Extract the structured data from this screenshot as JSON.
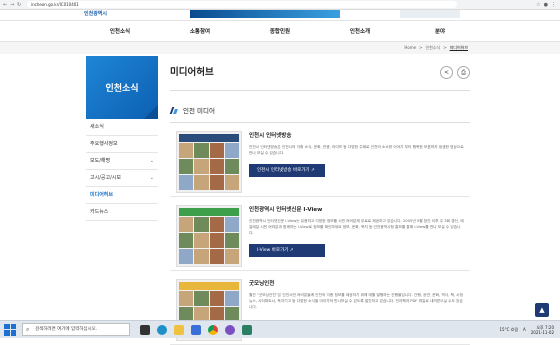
{
  "browser": {
    "url": "incheon.go.kr/IC010401",
    "nav_back": "←",
    "nav_fwd": "→",
    "reload": "↻"
  },
  "header": {
    "logo_text": "인천광역시"
  },
  "gnb": {
    "items": [
      "인천소식",
      "소통참여",
      "종합민원",
      "인천소개",
      "분야"
    ]
  },
  "breadcrumb": {
    "home": "Home",
    "sep": ">",
    "level1": "인천소식",
    "current": "미디어허브"
  },
  "lnb": {
    "title": "인천소식",
    "items": [
      {
        "label": "새소식",
        "chev": ""
      },
      {
        "label": "주요행사정보",
        "chev": ""
      },
      {
        "label": "보도/해명",
        "chev": "⌄"
      },
      {
        "label": "고시/공고/시보",
        "chev": "⌄"
      },
      {
        "label": "미디어허브",
        "chev": ""
      },
      {
        "label": "카드뉴스",
        "chev": ""
      }
    ]
  },
  "page": {
    "title": "미디어허브",
    "share_icon": "<",
    "print_icon": "⎙"
  },
  "section": {
    "title": "인천 미디어"
  },
  "cards": [
    {
      "title": "인천시 인터넷방송",
      "desc": "인천시 인터넷방송은 인천시의 각종 소식, 문화, 관광, 라이프 등 다양한 주제로 인천의 소소한 이야기 부터 행복한 모음까지 생생한 영상으로 만나 보실 수 있습니다.",
      "button": "인천시 인터넷방송 바로가기 ↗"
    },
    {
      "title": "인천광역시 인터넷신문 I-View",
      "desc": "인천광역시 인터넷신문 I-View는 유용하고 다양한 정보를 시민 여러분께 무료로 제공하고 있습니다. 2005년 5월 창간 이후 주 3회 갱신, 매일매일 시민 여러분과 함께하는 i-View로 정보를 확인하세요 정보, 문화, 복지 등 인천광역시청 홍보를 통해 I-View를 만나 보실 수 있습니다.",
      "button": "I-View 바로가기 ↗"
    },
    {
      "title": "굿모닝인천",
      "desc": "월간 “굿모닝인천”은 인천시민 여러분들께 인천의 각종 정보를 제공하기 위해 매월 발행하는 간행물입니다. 간행, 공연, 문화, 역사, 책, 시정뉴스, 시티파트너, 독자기고 등 다양한 소식을 아이가져 만나보실 수 있도록 발간하고 있습니다. 전자책과 PDF 파일로 내려받으실 수도 있습니다.",
      "button": ""
    }
  ],
  "taskbar": {
    "search_placeholder": "검색하려면 여기에 입력하십시오.",
    "weather": "15°C 흐림",
    "lang": "A",
    "time": "오후 7:20",
    "date": "2021-11-02"
  },
  "colors": {
    "accent": "#1f3a75",
    "lnb_blue": "#1a6fc7"
  }
}
